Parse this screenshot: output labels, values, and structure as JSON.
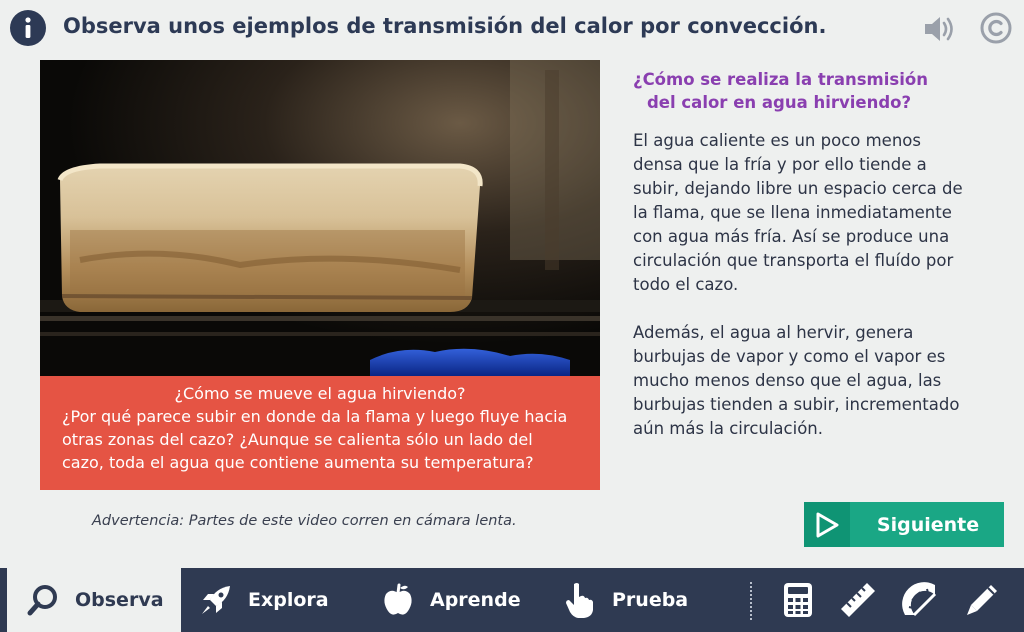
{
  "header": {
    "title": "Observa unos ejemplos de transmisión del calor por convección.",
    "icons": [
      "info-icon",
      "speaker-icon",
      "copyright-icon"
    ]
  },
  "video": {
    "caption_question": "¿Cómo se mueve el agua hirviendo?",
    "caption_body": "¿Por qué parece subir en donde da la flama y luego fluye hacia otras zonas del cazo? ¿Aunque se calienta sólo un lado del cazo, toda el agua que contiene aumenta su temperatura?",
    "warning": "Advertencia: Partes de este video corren en cámara lenta."
  },
  "side": {
    "heading_line1": "¿Cómo se realiza la transmisión",
    "heading_line2": "del calor en agua hirviendo?",
    "paragraph1": "El agua caliente es un poco menos densa que la fría y por ello tiende a subir, dejando libre un espacio cerca de la flama, que se llena inmediatamente con agua más fría. Así se produce una circulación que transporta el fluído por todo el cazo.",
    "paragraph2": "Además, el agua al hervir, genera burbujas de vapor y como el vapor es mucho menos denso que el agua, las burbujas tienden a subir, incrementado aún más la circulación."
  },
  "next_button": {
    "label": "Siguiente",
    "icon": "play-icon"
  },
  "nav": {
    "tabs": [
      {
        "label": "Observa",
        "icon": "magnifier-icon",
        "active": true
      },
      {
        "label": "Explora",
        "icon": "rocket-icon",
        "active": false
      },
      {
        "label": "Aprende",
        "icon": "apple-icon",
        "active": false
      },
      {
        "label": "Prueba",
        "icon": "pointer-hand-icon",
        "active": false
      }
    ],
    "tools": [
      "calculator-icon",
      "ruler-icon",
      "protractor-icon",
      "pencil-icon"
    ]
  },
  "colors": {
    "navy": "#2f3a52",
    "caption_red": "#e55444",
    "heading_purple": "#8a3fb0",
    "button_green": "#1aa785",
    "background": "#eef0ef"
  }
}
